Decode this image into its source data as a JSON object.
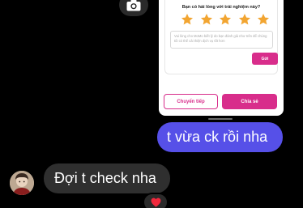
{
  "colors": {
    "background": "#000000",
    "outgoing_bubble": "#5650e8",
    "incoming_bubble": "#2f2f2f",
    "accent_pink": "#d82d8b",
    "star": "#f2a531"
  },
  "toolbar": {
    "camera_icon": "camera-icon"
  },
  "shared_screenshot": {
    "rating_question": "Bạn có hài lòng với trải nghiệm này?",
    "stars_filled": 5,
    "stars_total": 5,
    "feedback_placeholder": "Vui lòng cho MoMo biết lý do bạn đánh giá như trên để chúng tôi có thể cải thiện dịch vụ tốt hơn",
    "send_label": "Gửi",
    "forward_label": "Chuyển tiếp",
    "share_label": "Chia sẻ"
  },
  "messages": [
    {
      "direction": "outgoing",
      "text": "t vừa ck rồi nha"
    },
    {
      "direction": "incoming",
      "text": "Đợi t check nha",
      "reaction": "❤️"
    }
  ]
}
